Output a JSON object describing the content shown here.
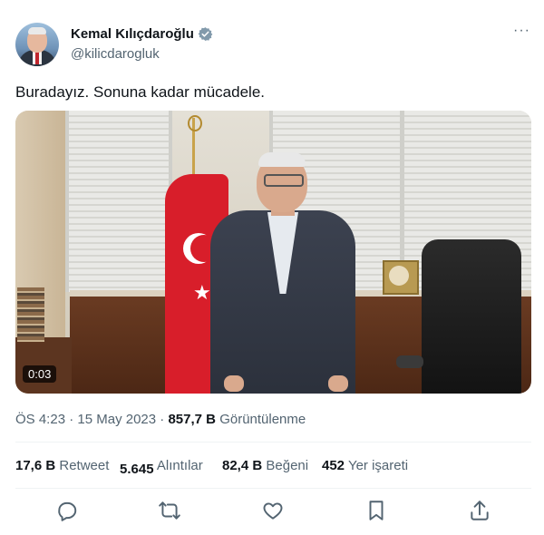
{
  "author": {
    "display_name": "Kemal Kılıçdaroğlu",
    "handle": "@kilicdarogluk",
    "verified": true
  },
  "more_menu_label": "···",
  "tweet": {
    "text": "Buradayız. Sonuna kadar mücadele."
  },
  "video": {
    "timestamp": "0:03"
  },
  "meta": {
    "time": "ÖS 4:23",
    "separator1": " · ",
    "date": "15 May 2023",
    "separator2": " · ",
    "views_count": "857,7 B",
    "views_label": "Görüntülenme"
  },
  "stats": [
    {
      "count": "17,6 B",
      "label": "Retweet"
    },
    {
      "count": "5.645",
      "label": "Alıntılar"
    },
    {
      "count": "82,4 B",
      "label": "Beğeni"
    },
    {
      "count": "452",
      "label": "Yer işareti"
    }
  ],
  "actions": [
    {
      "icon": "reply-icon"
    },
    {
      "icon": "retweet-icon"
    },
    {
      "icon": "like-icon"
    },
    {
      "icon": "bookmark-icon"
    },
    {
      "icon": "share-icon"
    }
  ],
  "colors": {
    "text_primary": "#0f1419",
    "text_secondary": "#536471",
    "verified": "#829aab"
  }
}
